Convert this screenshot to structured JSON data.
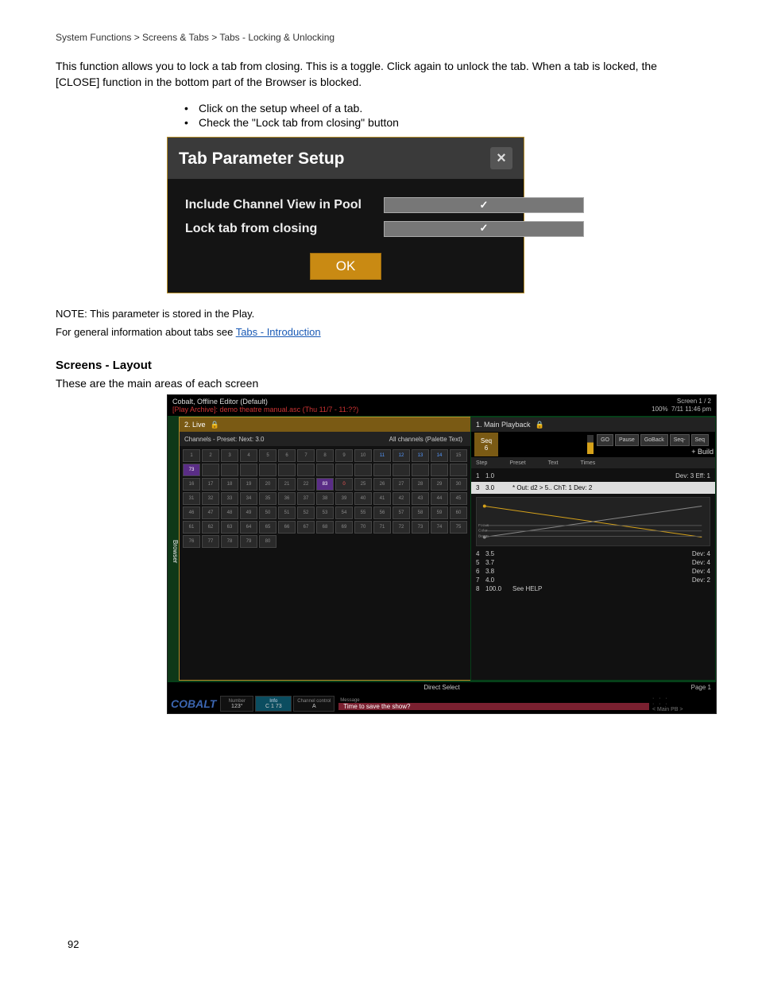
{
  "breadcrumb": "System Functions > Screens & Tabs > Tabs - Locking & Unlocking",
  "intro": "This function allows you to lock a tab from closing. This is a toggle. Click again to unlock the tab. When a tab is locked, the [CLOSE] function in the bottom part of the Browser is blocked.",
  "bullets": [
    "Click on the setup wheel of a tab.",
    "Check the \"Lock tab from closing\" button"
  ],
  "dialog": {
    "title": "Tab Parameter Setup",
    "row1": "Include Channel View in Pool",
    "row2": "Lock tab from closing",
    "ok": "OK"
  },
  "note": "NOTE: This parameter is stored in the Play.",
  "seealso_label": "For general information about tabs see ",
  "seealso_link": "Tabs - Introduction",
  "screens_title": "Screens - Layout",
  "screens_intro": "These are the main areas of each screen",
  "app": {
    "title": "Cobalt, Offline Editor (Default)",
    "archive": "[Play Archive]: demo theatre manual.asc (Thu 11/7 - 11:??)",
    "screen": "Screen 1 / 2",
    "zoom": "100%",
    "clock": "7/11 11:46 pm",
    "browser": "Browser",
    "left_tab": "2. Live",
    "left_sub_left": "Channels - Preset:   Next: 3.0",
    "left_sub_right": "All channels (Palette Text)",
    "grid_hl": "73",
    "grid_hl2": "83",
    "right_tab": "1. Main Playback",
    "seq_label": "Seq",
    "seq_num": "6",
    "buttons": [
      "GO",
      "Pause",
      "GoBack",
      "Seq-",
      "Seq"
    ],
    "build": "+ Build",
    "cols": [
      "Step",
      "Preset",
      "Text",
      "Times"
    ],
    "rows": [
      {
        "s": "1",
        "p": "1.0",
        "t": "",
        "d": "Dev: 3   Eff: 1"
      },
      {
        "s": "3",
        "p": "3.0",
        "t": "* Out: d2 > 5..   ChT: 1   Dev: 2",
        "d": "",
        "sel": true
      },
      {
        "s": "4",
        "p": "3.5",
        "t": "",
        "d": "Dev: 4"
      },
      {
        "s": "5",
        "p": "3.7",
        "t": "",
        "d": "Dev: 4"
      },
      {
        "s": "6",
        "p": "3.8",
        "t": "",
        "d": "Dev: 4"
      },
      {
        "s": "7",
        "p": "4.0",
        "t": "",
        "d": "Dev: 2"
      },
      {
        "s": "8",
        "p": "100.0",
        "t": "See HELP",
        "d": ""
      }
    ],
    "direct": "Direct Select",
    "page": "Page 1",
    "logo": "COBALT",
    "num_lbl": "Number",
    "num": "123°",
    "info_lbl": "Info",
    "info": "C 1 73",
    "ctrl_lbl": "Channel control",
    "ctrl": "A",
    "msg_lbl": "Message",
    "msg": "Time to save the show?",
    "mainpb": "< Main PB >"
  },
  "page_num": "92"
}
